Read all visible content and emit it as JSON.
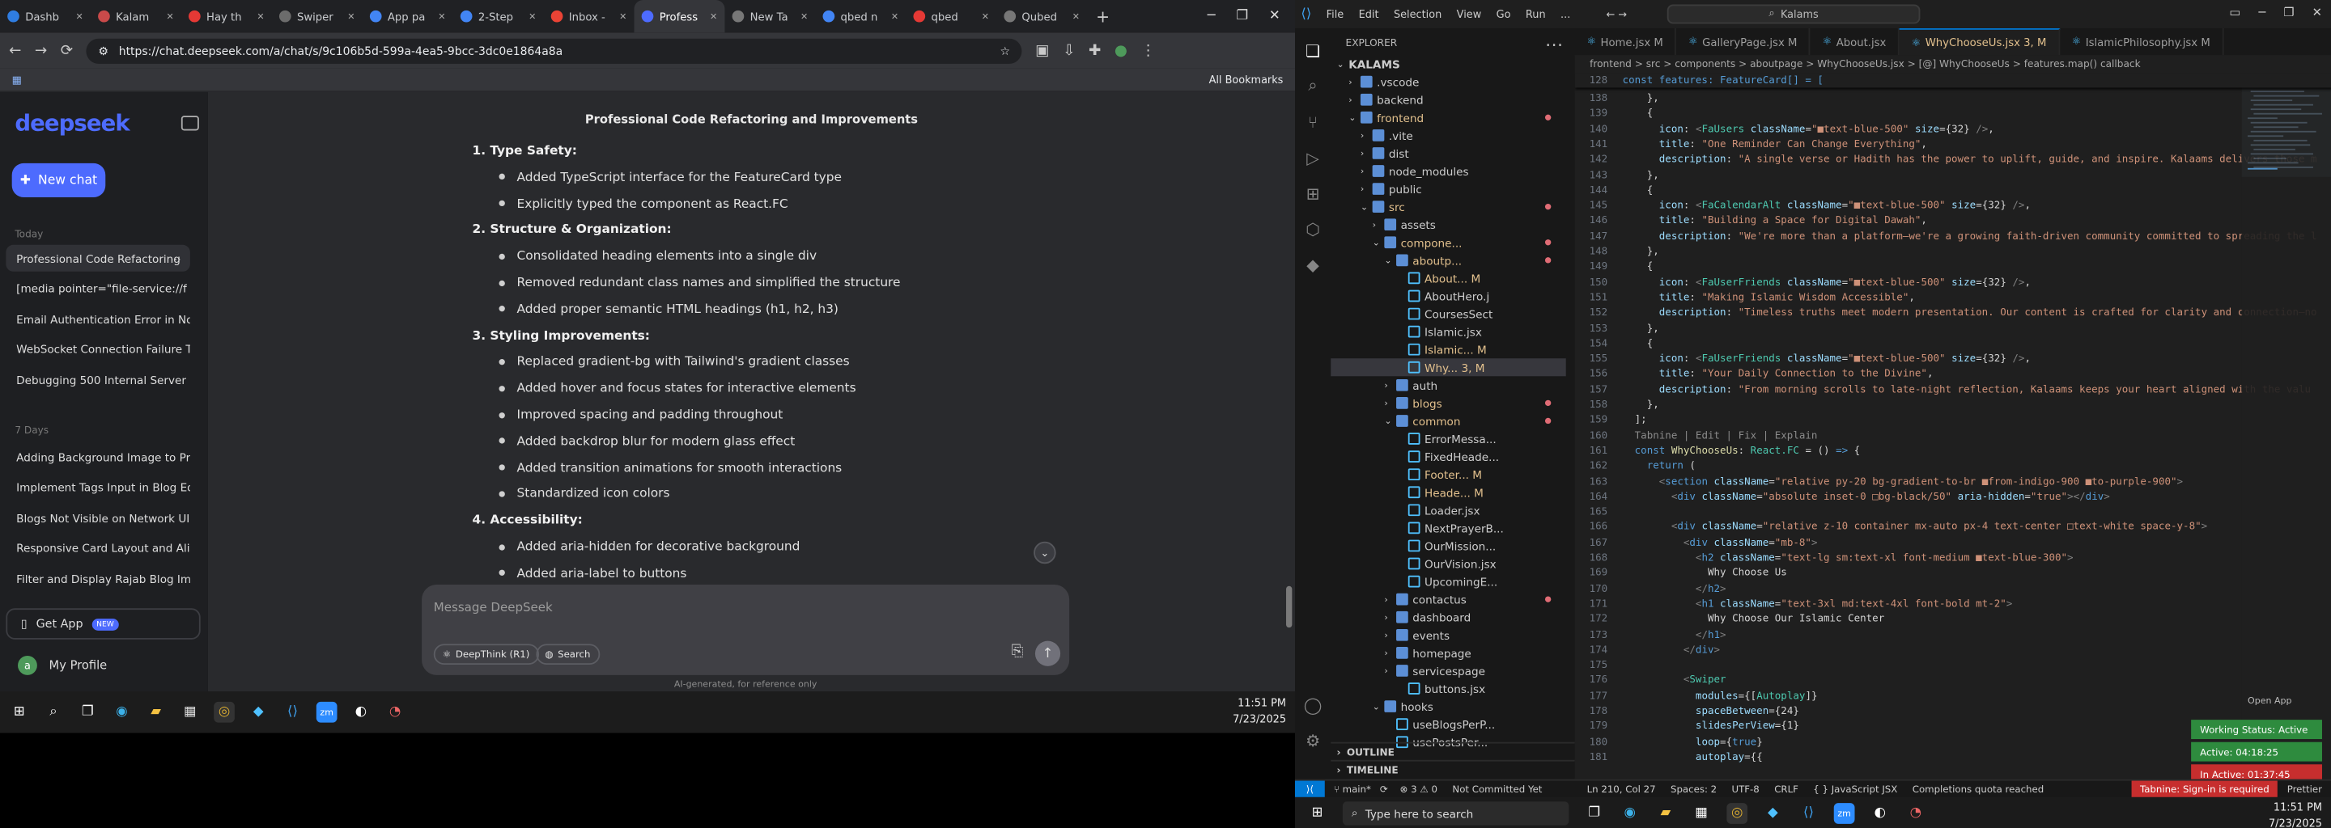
{
  "left": {
    "tabs": [
      {
        "label": "Dashb",
        "color": "#2f7de1"
      },
      {
        "label": "Kalam",
        "color": "#c94a4a"
      },
      {
        "label": "Hay th",
        "color": "#e53935"
      },
      {
        "label": "Swiper",
        "color": "#6c6c6c"
      },
      {
        "label": "App pa",
        "color": "#4285f4"
      },
      {
        "label": "2-Step",
        "color": "#4285f4"
      },
      {
        "label": "Inbox -",
        "color": "#ea4335"
      },
      {
        "label": "Profess",
        "color": "#4d6bfe"
      },
      {
        "label": "New Ta",
        "color": "#777777"
      },
      {
        "label": "qbed n",
        "color": "#4285f4"
      },
      {
        "label": "qbed",
        "color": "#e53935"
      },
      {
        "label": "Qubed",
        "color": "#777777"
      }
    ],
    "url": "https://chat.deepseek.com/a/chat/s/9c106b5d-599a-4ea5-9bcc-3dc0e1864a8a",
    "all_bookmarks": "All Bookmarks",
    "deepseek": {
      "logo": "deepseek",
      "new_chat": "New chat",
      "groups": {
        "today": "Today",
        "days7": "7 Days"
      },
      "history_today": [
        "Professional Code Refactoring",
        "[media pointer=\"file-service://f",
        "Email Authentication Error in No",
        "WebSocket Connection Failure T",
        "Debugging 500 Internal Server E"
      ],
      "history_7": [
        "Adding Background Image to Pr",
        "Implement Tags Input in Blog Ed",
        "Blogs Not Visible on Network UI",
        "Responsive Card Layout and Alig",
        "Filter and Display Rajab Blog Ima"
      ],
      "get_app": "Get App",
      "new_badge": "NEW",
      "profile_initial": "a",
      "my_profile": "My Profile",
      "chat_title": "Professional Code Refactoring and Improvements",
      "lines": [
        {
          "t": "1.  Type Safety:",
          "h": true
        },
        {
          "t": "Added TypeScript interface for the FeatureCard type",
          "b": true
        },
        {
          "t": "Explicitly typed the component as React.FC",
          "b": true
        },
        {
          "t": "2.  Structure & Organization:",
          "h": true
        },
        {
          "t": "Consolidated heading elements into a single div",
          "b": true
        },
        {
          "t": "Removed redundant class names and simplified the structure",
          "b": true
        },
        {
          "t": "Added proper semantic HTML headings (h1, h2, h3)",
          "b": true
        },
        {
          "t": "3.  Styling Improvements:",
          "h": true
        },
        {
          "t": "Replaced gradient-bg with Tailwind's gradient classes",
          "b": true
        },
        {
          "t": "Added hover and focus states for interactive elements",
          "b": true
        },
        {
          "t": "Improved spacing and padding throughout",
          "b": true
        },
        {
          "t": "Added backdrop blur for modern glass effect",
          "b": true
        },
        {
          "t": "Added transition animations for smooth interactions",
          "b": true
        },
        {
          "t": "Standardized icon colors",
          "b": true
        },
        {
          "t": "4.  Accessibility:",
          "h": true
        },
        {
          "t": "Added aria-hidden for decorative background",
          "b": true
        },
        {
          "t": "Added aria-label to buttons",
          "b": true
        }
      ],
      "message_placeholder": "Message DeepSeek",
      "deepthink": "DeepThink (R1)",
      "search": "Search",
      "disclaimer": "AI-generated, for reference only"
    },
    "clock": {
      "time": "11:51 PM",
      "date": "7/23/2025"
    }
  },
  "right": {
    "menu": [
      "File",
      "Edit",
      "Selection",
      "View",
      "Go",
      "Run",
      "..."
    ],
    "search": "Kalams",
    "explorer_header": "EXPLORER",
    "tree": [
      {
        "d": 0,
        "t": "KALAMS",
        "ch": "v",
        "bold": true
      },
      {
        "d": 1,
        "t": ".vscode",
        "ch": ">",
        "fold": true
      },
      {
        "d": 1,
        "t": "backend",
        "ch": ">",
        "fold": true
      },
      {
        "d": 1,
        "t": "frontend",
        "ch": "v",
        "fold": true,
        "mod": true,
        "dot": true
      },
      {
        "d": 2,
        "t": ".vite",
        "ch": ">",
        "fold": true
      },
      {
        "d": 2,
        "t": "dist",
        "ch": ">",
        "fold": true
      },
      {
        "d": 2,
        "t": "node_modules",
        "ch": ">",
        "fold": true
      },
      {
        "d": 2,
        "t": "public",
        "ch": ">",
        "fold": true
      },
      {
        "d": 2,
        "t": "src",
        "ch": "v",
        "fold": true,
        "mod": true,
        "dot": true
      },
      {
        "d": 3,
        "t": "assets",
        "ch": ">",
        "fold": true
      },
      {
        "d": 3,
        "t": "compone...",
        "ch": "v",
        "fold": true,
        "mod": true,
        "dot": true
      },
      {
        "d": 4,
        "t": "aboutp...",
        "ch": "v",
        "fold": true,
        "mod": true,
        "dot": true
      },
      {
        "d": 5,
        "t": "About...  M",
        "mod": true
      },
      {
        "d": 5,
        "t": "AboutHero.j"
      },
      {
        "d": 5,
        "t": "CoursesSect"
      },
      {
        "d": 5,
        "t": "Islamic.jsx"
      },
      {
        "d": 5,
        "t": "Islamic...  M",
        "mod": true
      },
      {
        "d": 5,
        "t": "Why...  3, M",
        "mod": true,
        "sel": true
      },
      {
        "d": 4,
        "t": "auth",
        "ch": ">",
        "fold": true
      },
      {
        "d": 4,
        "t": "blogs",
        "ch": ">",
        "fold": true,
        "mod": true,
        "dot": true
      },
      {
        "d": 4,
        "t": "common",
        "ch": "v",
        "fold": true,
        "mod": true,
        "dot": true
      },
      {
        "d": 5,
        "t": "ErrorMessa..."
      },
      {
        "d": 5,
        "t": "FixedHeade..."
      },
      {
        "d": 5,
        "t": "Footer...  M",
        "mod": true
      },
      {
        "d": 5,
        "t": "Heade...  M",
        "mod": true
      },
      {
        "d": 5,
        "t": "Loader.jsx"
      },
      {
        "d": 5,
        "t": "NextPrayerB..."
      },
      {
        "d": 5,
        "t": "OurMission..."
      },
      {
        "d": 5,
        "t": "OurVision.jsx"
      },
      {
        "d": 5,
        "t": "UpcomingE..."
      },
      {
        "d": 4,
        "t": "contactus",
        "ch": ">",
        "fold": true,
        "dot": true
      },
      {
        "d": 4,
        "t": "dashboard",
        "ch": ">",
        "fold": true
      },
      {
        "d": 4,
        "t": "events",
        "ch": ">",
        "fold": true
      },
      {
        "d": 4,
        "t": "homepage",
        "ch": ">",
        "fold": true
      },
      {
        "d": 4,
        "t": "servicespage",
        "ch": ">",
        "fold": true
      },
      {
        "d": 5,
        "t": "buttons.jsx"
      },
      {
        "d": 3,
        "t": "hooks",
        "ch": "v",
        "fold": true
      },
      {
        "d": 4,
        "t": "useBlogsPerP..."
      },
      {
        "d": 4,
        "t": "usePostsPer..."
      }
    ],
    "outline": "OUTLINE",
    "timeline": "TIMELINE",
    "editor_tabs": [
      {
        "t": "Home.jsx  M"
      },
      {
        "t": "GalleryPage.jsx  M"
      },
      {
        "t": "About.jsx"
      },
      {
        "t": "WhyChooseUs.jsx  3, M",
        "on": true
      },
      {
        "t": "IslamicPhilosophy.jsx  M"
      }
    ],
    "breadcrumb": "frontend > src > components > aboutpage > WhyChooseUs.jsx > [@] WhyChooseUs > features.map() callback",
    "sticky": "const features: FeatureCard[] = [",
    "code": [
      {
        "n": "138",
        "h": "    <span class='tx'>},</span>"
      },
      {
        "n": "139",
        "h": "    <span class='tx'>{</span>"
      },
      {
        "n": "140",
        "h": "      <span class='p'>icon</span><span class='tx'>: </span><span class='j'>&lt;</span><span class='t'>FaUsers</span> <span class='p'>className</span><span class='tx'>=</span><span class='s'>\"■text-blue-500\"</span> <span class='p'>size</span><span class='tx'>={32} </span><span class='j'>/&gt;</span><span class='tx'>,</span>"
      },
      {
        "n": "141",
        "h": "      <span class='p'>title</span><span class='tx'>: </span><span class='s'>\"One Reminder Can Change Everything\"</span><span class='tx'>,</span>"
      },
      {
        "n": "142",
        "h": "      <span class='p'>description</span><span class='tx'>: </span><span class='s'>\"A single verse or Hadith has the power to uplift, guide, and inspire. Kalaams delivers those m</span>"
      },
      {
        "n": "143",
        "h": "    <span class='tx'>},</span>"
      },
      {
        "n": "144",
        "h": "    <span class='tx'>{</span>"
      },
      {
        "n": "145",
        "h": "      <span class='p'>icon</span><span class='tx'>: </span><span class='j'>&lt;</span><span class='t'>FaCalendarAlt</span> <span class='p'>className</span><span class='tx'>=</span><span class='s'>\"■text-blue-500\"</span> <span class='p'>size</span><span class='tx'>={32} </span><span class='j'>/&gt;</span><span class='tx'>,</span>"
      },
      {
        "n": "146",
        "h": "      <span class='p'>title</span><span class='tx'>: </span><span class='s'>\"Building a Space for Digital Dawah\"</span><span class='tx'>,</span>"
      },
      {
        "n": "147",
        "h": "      <span class='p'>description</span><span class='tx'>: </span><span class='s'>\"We're more than a platform—we're a growing faith-driven community committed to spreading the l</span>"
      },
      {
        "n": "148",
        "h": "    <span class='tx'>},</span>"
      },
      {
        "n": "149",
        "h": "    <span class='tx'>{</span>"
      },
      {
        "n": "150",
        "h": "      <span class='p'>icon</span><span class='tx'>: </span><span class='j'>&lt;</span><span class='t'>FaUserFriends</span> <span class='p'>className</span><span class='tx'>=</span><span class='s'>\"■text-blue-500\"</span> <span class='p'>size</span><span class='tx'>={32} </span><span class='j'>/&gt;</span><span class='tx'>,</span>"
      },
      {
        "n": "151",
        "h": "      <span class='p'>title</span><span class='tx'>: </span><span class='s'>\"Making Islamic Wisdom Accessible\"</span><span class='tx'>,</span>"
      },
      {
        "n": "152",
        "h": "      <span class='p'>description</span><span class='tx'>: </span><span class='s'>\"Timeless truths meet modern presentation. Our content is crafted for clarity and connection—no</span>"
      },
      {
        "n": "153",
        "h": "    <span class='tx'>},</span>"
      },
      {
        "n": "154",
        "h": "    <span class='tx'>{</span>"
      },
      {
        "n": "155",
        "h": "      <span class='p'>icon</span><span class='tx'>: </span><span class='j'>&lt;</span><span class='t'>FaUserFriends</span> <span class='p'>className</span><span class='tx'>=</span><span class='s'>\"■text-blue-500\"</span> <span class='p'>size</span><span class='tx'>={32} </span><span class='j'>/&gt;</span><span class='tx'>,</span>"
      },
      {
        "n": "156",
        "h": "      <span class='p'>title</span><span class='tx'>: </span><span class='s'>\"Your Daily Connection to the Divine\"</span><span class='tx'>,</span>"
      },
      {
        "n": "157",
        "h": "      <span class='p'>description</span><span class='tx'>: </span><span class='s'>\"From morning scrolls to late-night reflection, Kalaams keeps your heart aligned with the valu</span>"
      },
      {
        "n": "158",
        "h": "    <span class='tx'>},</span>"
      },
      {
        "n": "159",
        "h": "  <span class='tx'>];</span>"
      },
      {
        "n": "160",
        "h": "  <span class='cmt'>Tabnine | Edit | Fix | Explain</span>"
      },
      {
        "n": "161",
        "h": "  <span class='k'>const</span> <span class='f'>WhyChooseUs</span><span class='tx'>: </span><span class='t'>React.FC</span> <span class='tx'>= () </span><span class='k'>=&gt;</span> <span class='tx'>{</span>"
      },
      {
        "n": "162",
        "h": "    <span class='k'>return</span> <span class='tx'>(</span>"
      },
      {
        "n": "163",
        "h": "      <span class='j'>&lt;</span><span class='k'>section</span> <span class='p'>className</span><span class='tx'>=</span><span class='s'>\"relative py-20 bg-gradient-to-br ■from-indigo-900 ■to-purple-900\"</span><span class='j'>&gt;</span>"
      },
      {
        "n": "164",
        "h": "        <span class='j'>&lt;</span><span class='k'>div</span> <span class='p'>className</span><span class='tx'>=</span><span class='s'>\"absolute inset-0 □bg-black/50\"</span> <span class='p'>aria-hidden</span><span class='tx'>=</span><span class='s'>\"true\"</span><span class='j'>&gt;&lt;/</span><span class='k'>div</span><span class='j'>&gt;</span>"
      },
      {
        "n": "165",
        "h": " "
      },
      {
        "n": "166",
        "h": "        <span class='j'>&lt;</span><span class='k'>div</span> <span class='p'>className</span><span class='tx'>=</span><span class='s'>\"relative z-10 container mx-auto px-4 text-center □text-white space-y-8\"</span><span class='j'>&gt;</span>"
      },
      {
        "n": "167",
        "h": "          <span class='j'>&lt;</span><span class='k'>div</span> <span class='p'>className</span><span class='tx'>=</span><span class='s'>\"mb-8\"</span><span class='j'>&gt;</span>"
      },
      {
        "n": "168",
        "h": "            <span class='j'>&lt;</span><span class='k'>h2</span> <span class='p'>className</span><span class='tx'>=</span><span class='s'>\"text-lg sm:text-xl font-medium ■text-blue-300\"</span><span class='j'>&gt;</span>"
      },
      {
        "n": "169",
        "h": "              <span class='tx'>Why Choose Us</span>"
      },
      {
        "n": "170",
        "h": "            <span class='j'>&lt;/</span><span class='k'>h2</span><span class='j'>&gt;</span>"
      },
      {
        "n": "171",
        "h": "            <span class='j'>&lt;</span><span class='k'>h1</span> <span class='p'>className</span><span class='tx'>=</span><span class='s'>\"text-3xl md:text-4xl font-bold mt-2\"</span><span class='j'>&gt;</span>"
      },
      {
        "n": "172",
        "h": "              <span class='tx'>Why Choose Our Islamic Center</span>"
      },
      {
        "n": "173",
        "h": "            <span class='j'>&lt;/</span><span class='k'>h1</span><span class='j'>&gt;</span>"
      },
      {
        "n": "174",
        "h": "          <span class='j'>&lt;/</span><span class='k'>div</span><span class='j'>&gt;</span>"
      },
      {
        "n": "175",
        "h": " "
      },
      {
        "n": "176",
        "h": "          <span class='j'>&lt;</span><span class='t'>Swiper</span>"
      },
      {
        "n": "177",
        "h": "            <span class='p'>modules</span><span class='tx'>={[</span><span class='t'>Autoplay</span><span class='tx'>]}</span>"
      },
      {
        "n": "178",
        "h": "            <span class='p'>spaceBetween</span><span class='tx'>={24}</span>"
      },
      {
        "n": "179",
        "h": "            <span class='p'>slidesPerView</span><span class='tx'>={1}</span>"
      },
      {
        "n": "180",
        "h": "            <span class='p'>loop</span><span class='tx'>={</span><span class='k'>true</span><span class='tx'>}</span>"
      },
      {
        "n": "181",
        "h": "            <span class='p'>autoplay</span><span class='tx'>={{</span>"
      }
    ],
    "status": {
      "branch": "main*",
      "problems": "⊗ 3 ⚠ 0",
      "uncommitted": "Not Committed Yet",
      "pos": "Ln 210, Col 27",
      "spaces": "Spaces: 2",
      "enc": "UTF-8",
      "eol": "CRLF",
      "lang": "{ } JavaScript JSX",
      "quota": "Completions quota reached",
      "tabnine": "Tabnine: Sign-in is required",
      "prettier": "Prettier"
    },
    "open_app": "Open App",
    "working": [
      {
        "t": "Working Status: Active",
        "c": "#2e8b3e"
      },
      {
        "t": "Active: 04:18:25",
        "c": "#2e8b3e"
      },
      {
        "t": "In Active: 01:37:45",
        "c": "#c72e2e"
      }
    ],
    "search_taskbar": "Type here to search",
    "clock": {
      "time": "11:51 PM",
      "date": "7/23/2025"
    }
  }
}
